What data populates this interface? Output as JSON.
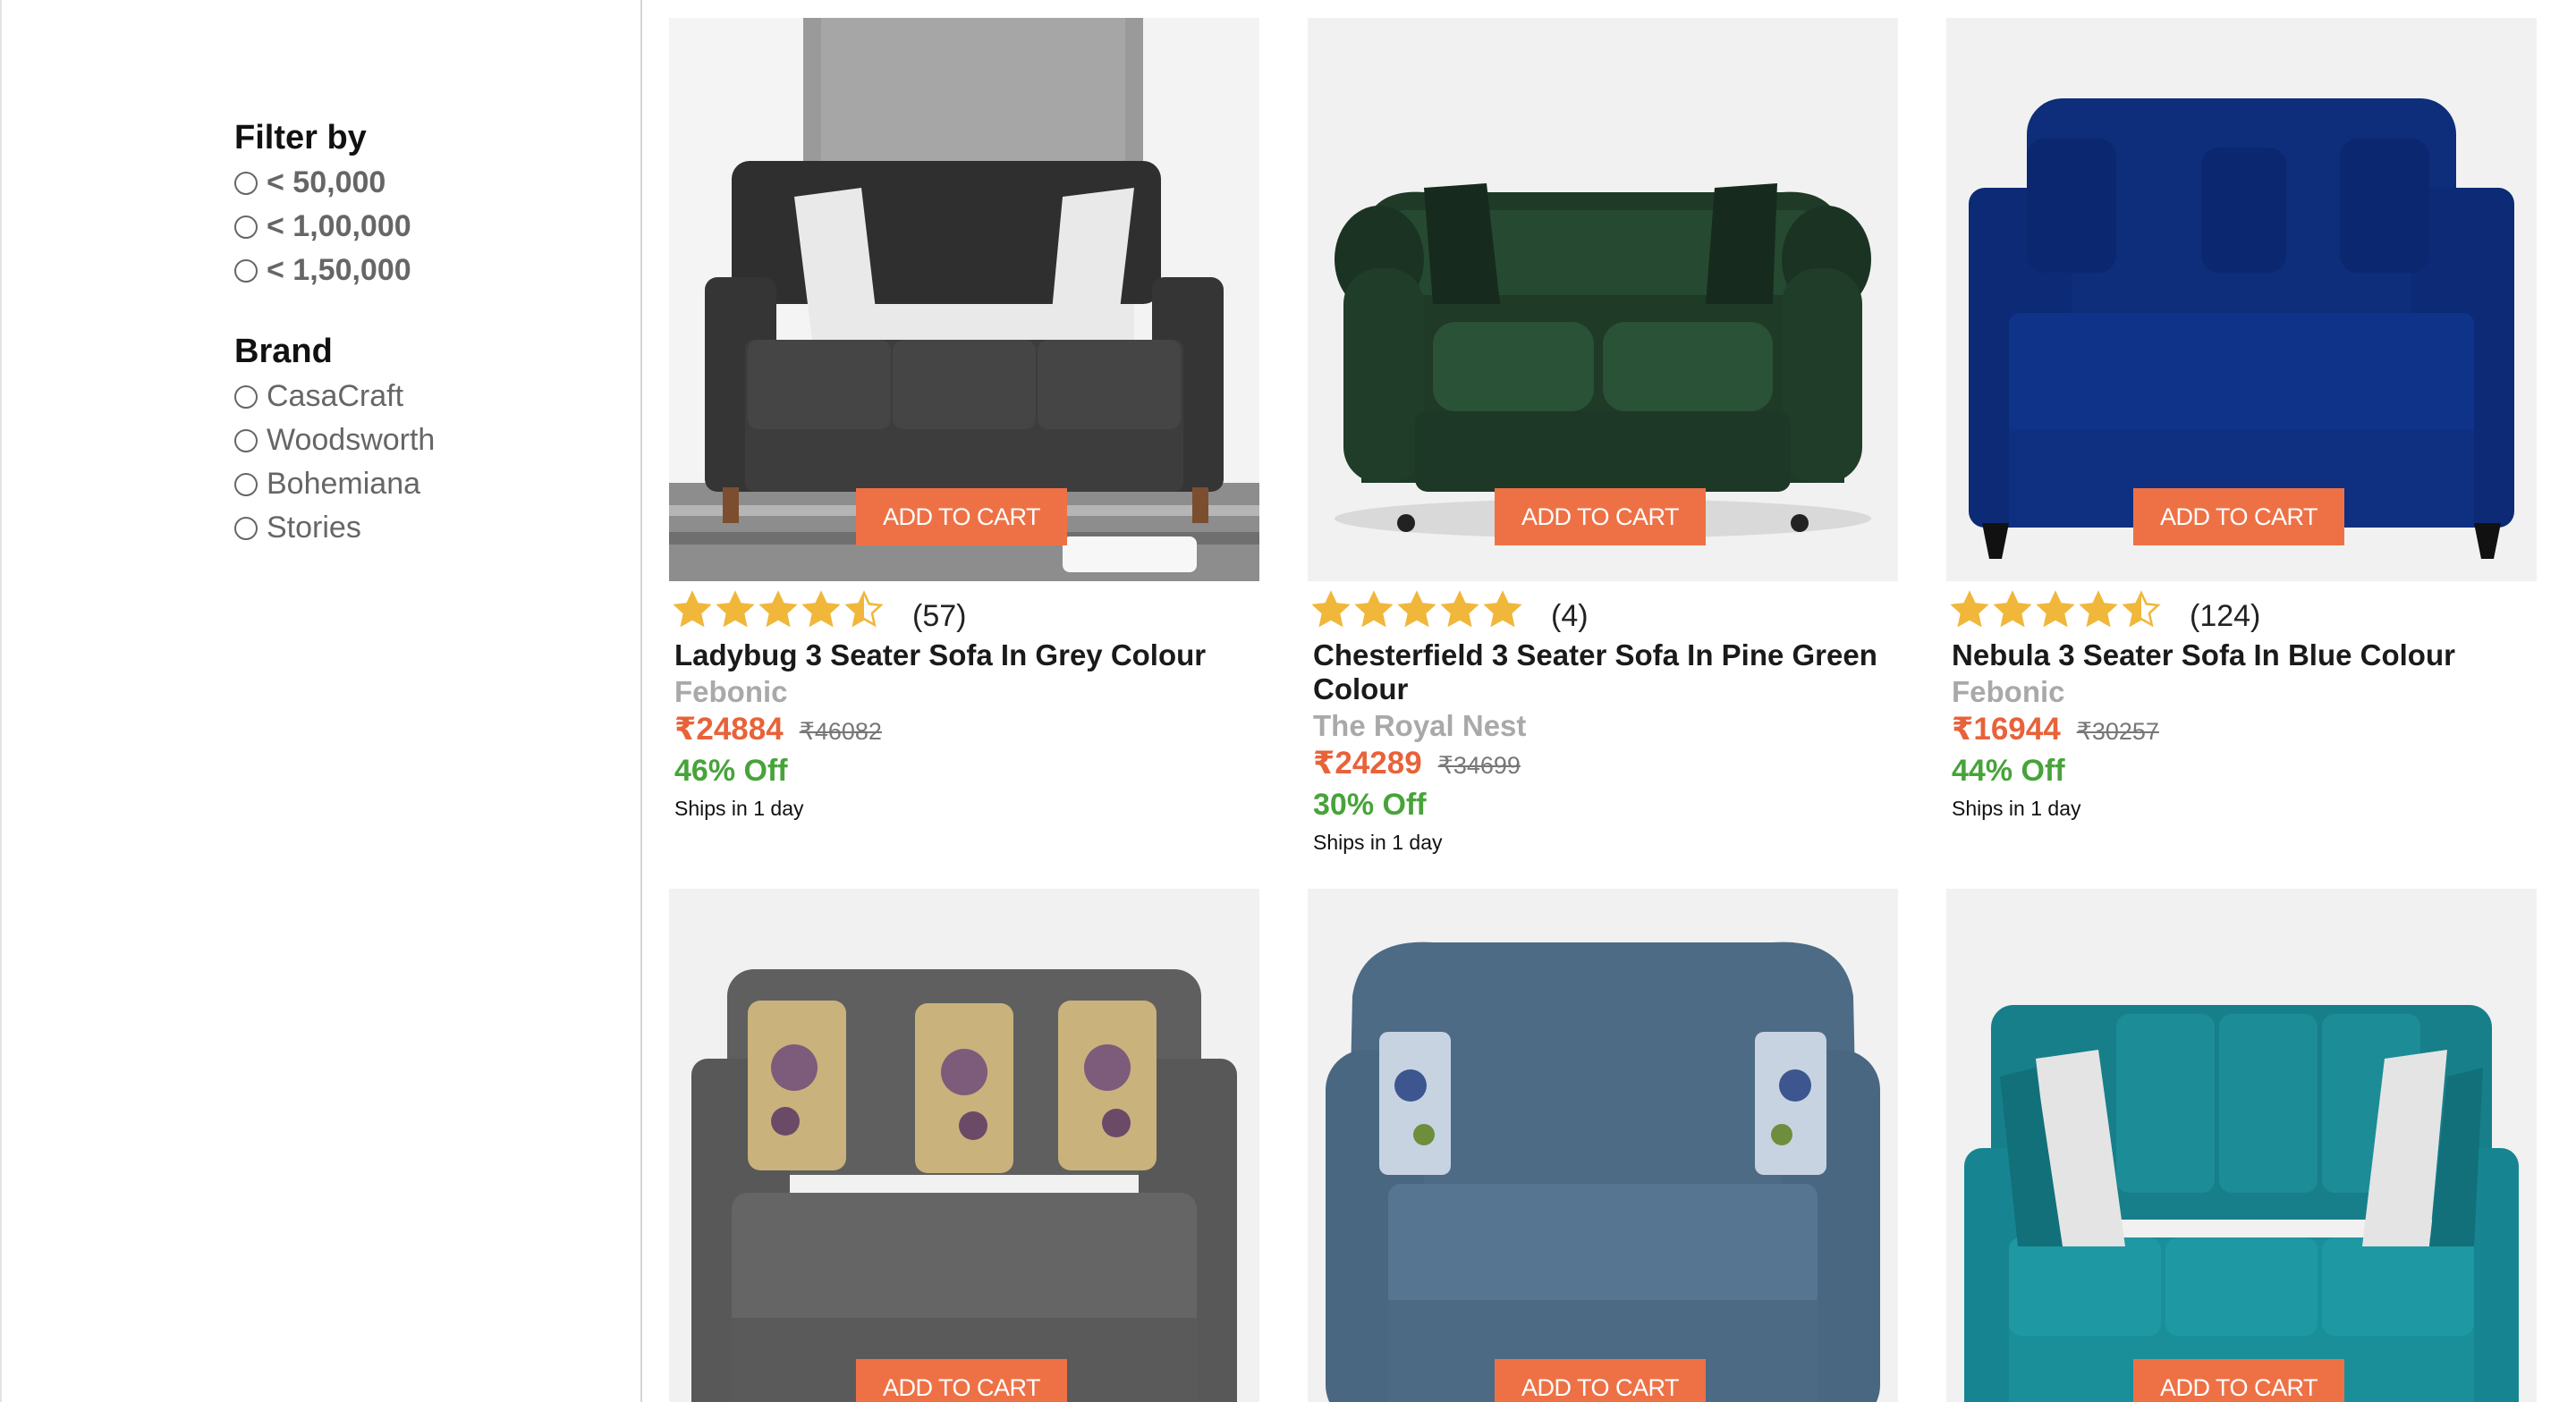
{
  "filters": {
    "price_title": "Filter by",
    "price_options": [
      "< 50,000",
      "< 1,00,000",
      "< 1,50,000"
    ],
    "brand_title": "Brand",
    "brand_options": [
      "CasaCraft",
      "Woodsworth",
      "Bohemiana",
      "Stories"
    ]
  },
  "colors": {
    "accent_button": "#ee7146",
    "price": "#e8623a",
    "discount": "#47a33a",
    "star": "#f0b73a"
  },
  "products": [
    {
      "cart_label": "ADD TO CART",
      "rating": 4.5,
      "rating_count": "(57)",
      "name": "Ladybug 3 Seater Sofa In Grey Colour",
      "brand": "Febonic",
      "price": "₹24884",
      "mrp": "₹46082",
      "discount": "46% Off",
      "shipping": "Ships in 1 day",
      "image_icon": "grey-sofa-image"
    },
    {
      "cart_label": "ADD TO CART",
      "rating": 5,
      "rating_count": "(4)",
      "name": "Chesterfield 3 Seater Sofa In Pine Green Colour",
      "brand": "The Royal Nest",
      "price": "₹24289",
      "mrp": "₹34699",
      "discount": "30% Off",
      "shipping": "Ships in 1 day",
      "image_icon": "green-chesterfield-sofa-image"
    },
    {
      "cart_label": "ADD TO CART",
      "rating": 4.5,
      "rating_count": "(124)",
      "name": "Nebula 3 Seater Sofa In Blue Colour",
      "brand": "Febonic",
      "price": "₹16944",
      "mrp": "₹30257",
      "discount": "44% Off",
      "shipping": "Ships in 1 day",
      "image_icon": "blue-sofa-image"
    },
    {
      "cart_label": "ADD TO CART",
      "image_icon": "dark-grey-sofa-image"
    },
    {
      "cart_label": "ADD TO CART",
      "image_icon": "slate-blue-sofa-image"
    },
    {
      "cart_label": "ADD TO CART",
      "image_icon": "teal-sofa-image"
    }
  ]
}
